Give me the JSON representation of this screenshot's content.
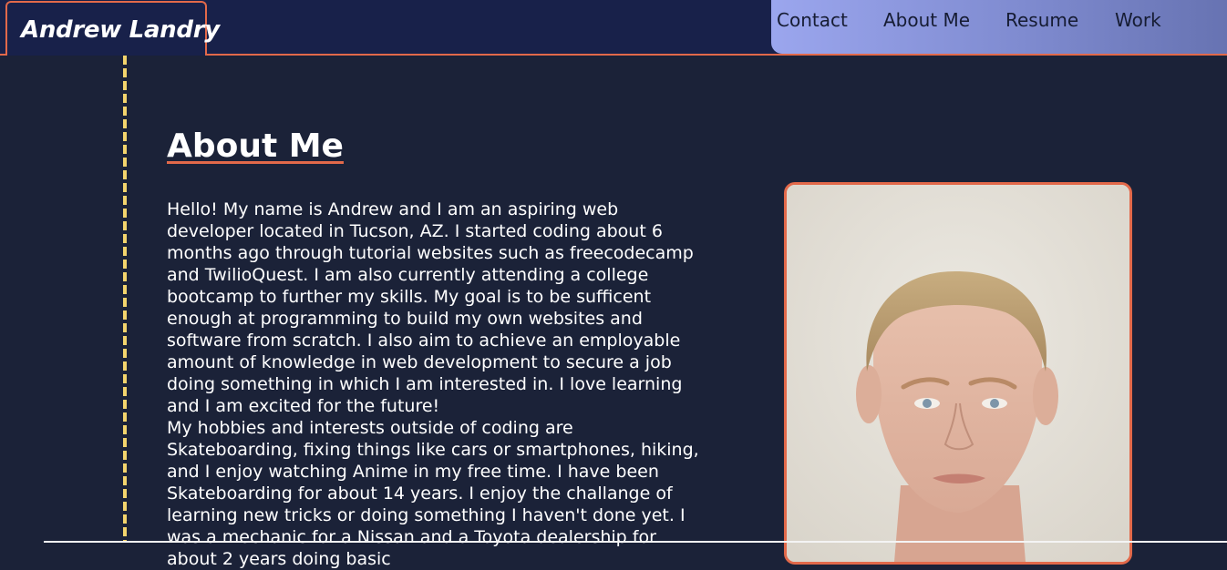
{
  "header": {
    "brand": "Andrew Landry",
    "nav": [
      "Contact",
      "About Me",
      "Resume",
      "Work"
    ]
  },
  "main": {
    "title": "About Me",
    "paragraphs": [
      "Hello! My name is Andrew and I am an aspiring web developer located in Tucson, AZ. I started coding about 6 months ago through tutorial websites such as freecodecamp and TwilioQuest. I am also currently attending a college bootcamp to further my skills. My goal is to be sufficent enough at programming to build my own websites and software from scratch. I also aim to achieve an employable amount of knowledge in web development to secure a job doing something in which I am interested in. I love learning and I am excited for the future!",
      "My hobbies and interests outside of coding are Skateboarding, fixing things like cars or smartphones, hiking, and I enjoy watching Anime in my free time. I have been Skateboarding for about 14 years. I enjoy the challange of learning new tricks or doing something I haven't done yet. I was a mechanic for a Nissan and a Toyota dealership for about 2 years doing basic"
    ]
  },
  "colors": {
    "background": "#1b2238",
    "header": "#18214a",
    "accent": "#e2694a",
    "rail": "#f3d46c",
    "nav_gradient_start": "#9ba6ee",
    "nav_gradient_end": "#6773b2"
  }
}
